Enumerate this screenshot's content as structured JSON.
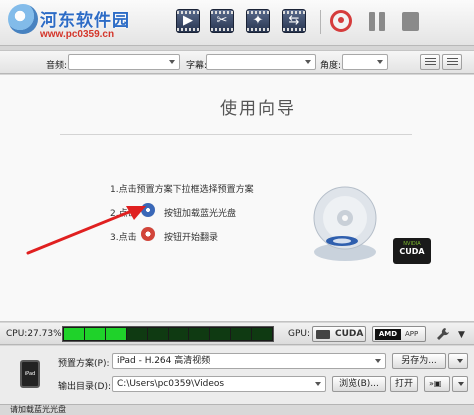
{
  "watermark": {
    "title": "河东软件园",
    "url": "www.pc0359.cn"
  },
  "toolbar": {
    "icons": [
      "open-disc-icon",
      "add-video-icon",
      "clip-icon",
      "effect-icon",
      "merge-icon",
      "convert-icon",
      "pause-icon",
      "stop-icon"
    ]
  },
  "selectors": {
    "audio_label": "音频:",
    "subtitle_label": "字幕:",
    "angle_label": "角度:"
  },
  "wizard": {
    "title": "使用向导",
    "step1": "1.点击预置方案下拉框选择预置方案",
    "step2_prefix": "2.点击",
    "step2_suffix": "按钮加载蓝光光盘",
    "step3_prefix": "3.点击",
    "step3_suffix": "按钮开始翻录"
  },
  "badges": {
    "nvidia": "NVIDIA",
    "cuda": "CUDA"
  },
  "cpu": {
    "label": "CPU:27.73%",
    "segments_total": 10,
    "segments_lit": 3
  },
  "gpu": {
    "label": "GPU:",
    "cuda": "CUDA",
    "amd": "AMD",
    "app": "APP"
  },
  "profile": {
    "label": "预置方案(P):",
    "value": "iPad - H.264 高清视频",
    "save_as": "另存为..."
  },
  "output": {
    "label": "输出目录(D):",
    "value": "C:\\Users\\pc0359\\Videos",
    "browse": "浏览(B)...",
    "open": "打开"
  },
  "device_icon_label": "iPad",
  "status": {
    "text": "请加载蓝光光盘"
  },
  "colors": {
    "accent_blue": "#2d6cc6",
    "accent_red": "#d53c3c",
    "cpu_green": "#1fd22a"
  }
}
